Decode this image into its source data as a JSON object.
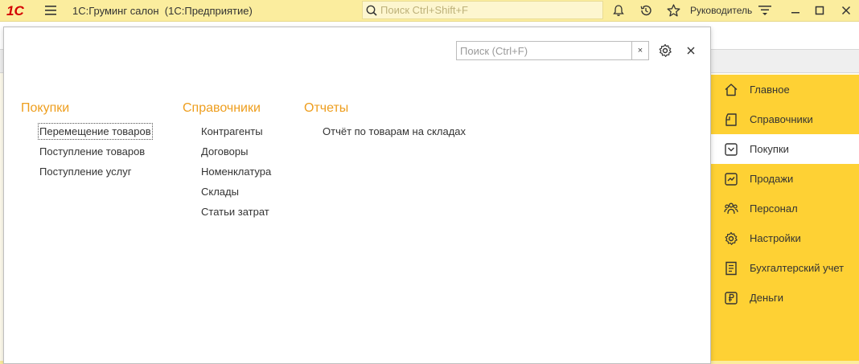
{
  "titlebar": {
    "logo": "1С",
    "title": "1С:Груминг салон  (1С:Предприятие)",
    "search_placeholder": "Поиск Ctrl+Shift+F",
    "user": "Руководитель"
  },
  "popup": {
    "search_placeholder": "Поиск (Ctrl+F)",
    "clear_symbol": "×",
    "columns": [
      {
        "title": "Покупки",
        "items": [
          "Перемещение товаров",
          "Поступление товаров",
          "Поступление услуг"
        ]
      },
      {
        "title": "Справочники",
        "items": [
          "Контрагенты",
          "Договоры",
          "Номенклатура",
          "Склады",
          "Статьи затрат"
        ]
      },
      {
        "title": "Отчеты",
        "items": [
          "Отчёт по товарам на складах"
        ]
      }
    ]
  },
  "sections": [
    {
      "label": "Главное",
      "icon": "home-icon"
    },
    {
      "label": "Справочники",
      "icon": "catalog-icon"
    },
    {
      "label": "Покупки",
      "icon": "cart-icon",
      "active": true
    },
    {
      "label": "Продажи",
      "icon": "sales-chart-icon"
    },
    {
      "label": "Персонал",
      "icon": "people-icon"
    },
    {
      "label": "Настройки",
      "icon": "gear-icon"
    },
    {
      "label": "Бухгалтерский учет",
      "icon": "ledger-icon"
    },
    {
      "label": "Деньги",
      "icon": "ruble-icon"
    }
  ],
  "colors": {
    "titlebar_bg": "#fbed9e",
    "sections_bg": "#fed134",
    "menu_header": "#ee9e1e"
  }
}
